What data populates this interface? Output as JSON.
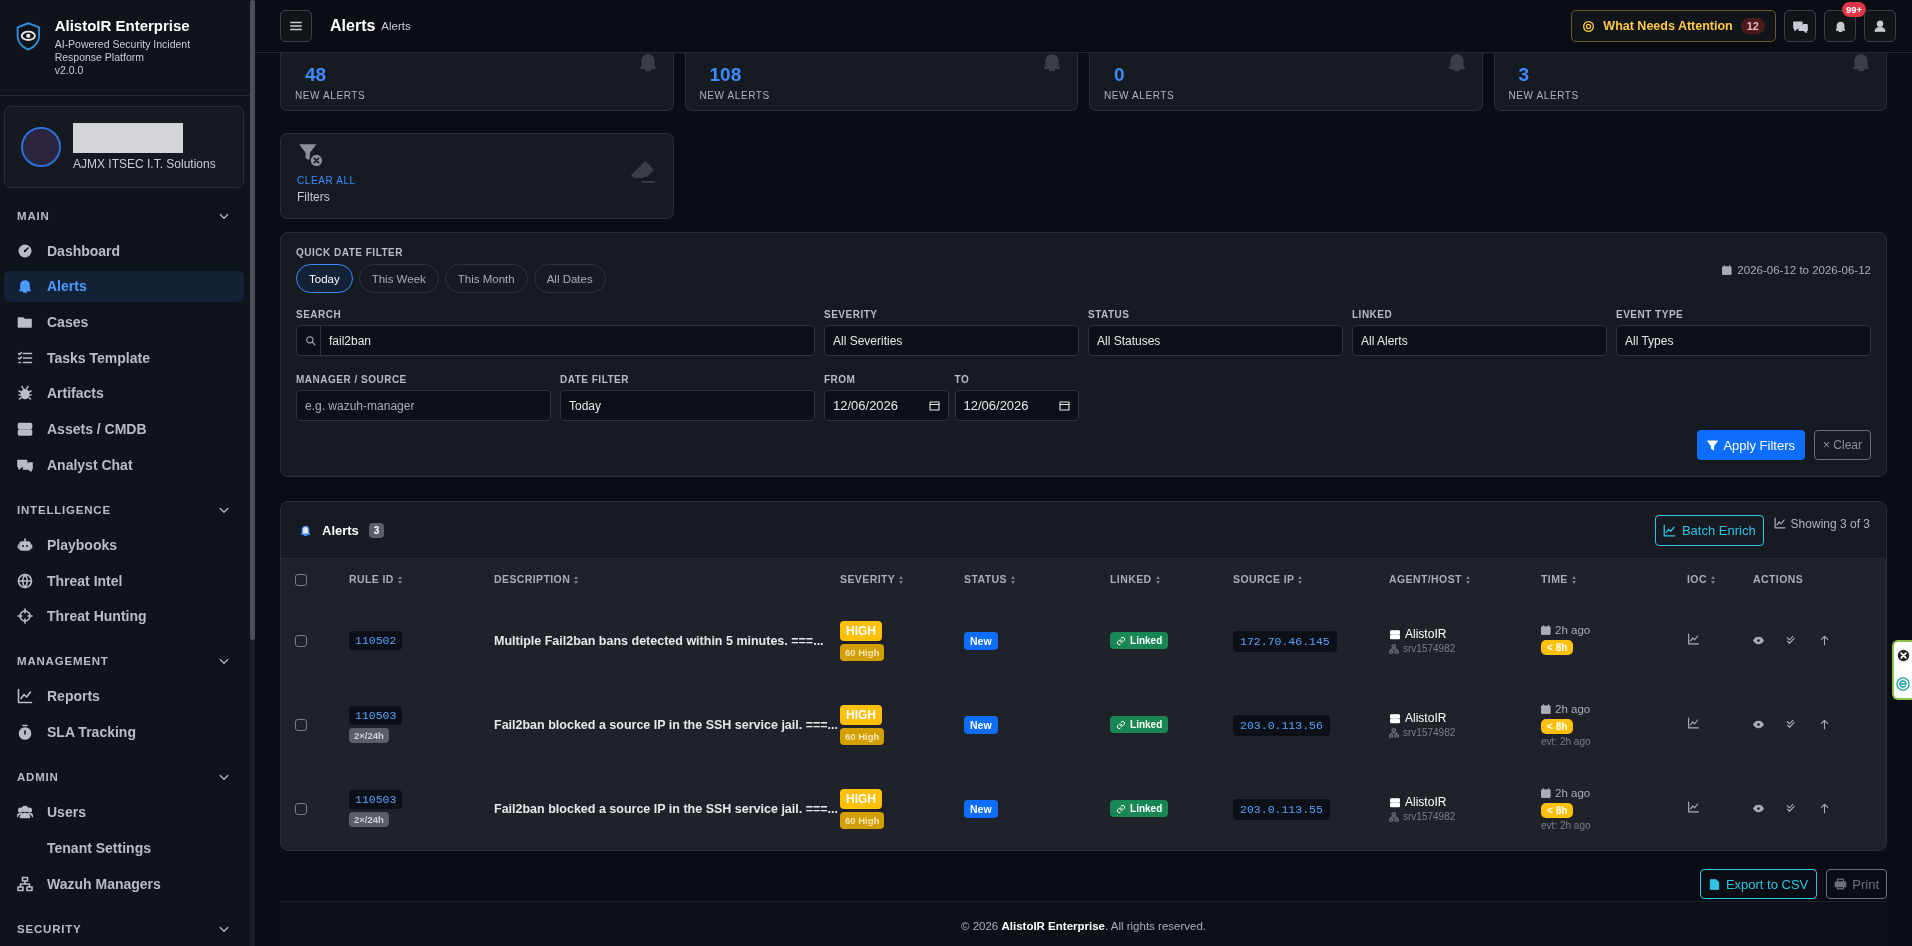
{
  "sidebar": {
    "brand": {
      "name": "AlistoIR Enterprise",
      "tagline": "AI-Powered Security Incident Response Platform",
      "version": "v2.0.0"
    },
    "user": {
      "organization": "AJMX ITSEC I.T. Solutions"
    },
    "sections": [
      {
        "title": "MAIN",
        "expanded": true,
        "items": [
          {
            "label": "Dashboard",
            "selected": false
          },
          {
            "label": "Alerts",
            "selected": true
          },
          {
            "label": "Cases",
            "selected": false
          },
          {
            "label": "Tasks Template",
            "selected": false
          },
          {
            "label": "Artifacts",
            "selected": false
          },
          {
            "label": "Assets / CMDB",
            "selected": false
          },
          {
            "label": "Analyst Chat",
            "selected": false
          }
        ]
      },
      {
        "title": "INTELLIGENCE",
        "expanded": true,
        "items": [
          {
            "label": "Playbooks",
            "selected": false
          },
          {
            "label": "Threat Intel",
            "selected": false
          },
          {
            "label": "Threat Hunting",
            "selected": false
          }
        ]
      },
      {
        "title": "MANAGEMENT",
        "expanded": true,
        "items": [
          {
            "label": "Reports",
            "selected": false
          },
          {
            "label": "SLA Tracking",
            "selected": false
          }
        ]
      },
      {
        "title": "ADMIN",
        "expanded": true,
        "items": [
          {
            "label": "Users",
            "selected": false
          },
          {
            "label": "Tenant Settings",
            "selected": false
          },
          {
            "label": "Wazuh Managers",
            "selected": false
          }
        ]
      },
      {
        "title": "SECURITY",
        "expanded": true
      }
    ]
  },
  "header": {
    "title": "Alerts",
    "breadcrumb": "Alerts",
    "attention": {
      "label": "What Needs Attention",
      "count": "12"
    },
    "notification_count": "99+"
  },
  "stats": [
    {
      "value": "48",
      "label": "NEW ALERTS"
    },
    {
      "value": "108",
      "label": "NEW ALERTS"
    },
    {
      "value": "0",
      "label": "NEW ALERTS"
    },
    {
      "value": "3",
      "label": "NEW ALERTS"
    }
  ],
  "filter_card": {
    "action": "CLEAR ALL",
    "label": "Filters"
  },
  "filters": {
    "quick_title": "QUICK DATE FILTER",
    "quick": [
      {
        "label": "Today",
        "selected": true
      },
      {
        "label": "This Week",
        "selected": false
      },
      {
        "label": "This Month",
        "selected": false
      },
      {
        "label": "All Dates",
        "selected": false
      }
    ],
    "range": "2026-06-12 to 2026-06-12",
    "fields": [
      {
        "kind": "search",
        "label": "SEARCH",
        "value": "fail2ban"
      },
      {
        "kind": "select",
        "label": "SEVERITY",
        "value": "All Severities"
      },
      {
        "kind": "select",
        "label": "STATUS",
        "value": "All Statuses"
      },
      {
        "kind": "select",
        "label": "LINKED",
        "value": "All Alerts"
      },
      {
        "kind": "select",
        "label": "EVENT TYPE",
        "value": "All Types"
      },
      {
        "kind": "text",
        "label": "MANAGER / SOURCE",
        "placeholder": "e.g. wazuh-manager"
      },
      {
        "kind": "select",
        "label": "DATE FILTER",
        "value": "Today"
      },
      {
        "kind": "date",
        "label": "FROM",
        "value": "12/06/2026"
      },
      {
        "kind": "date",
        "label": "TO",
        "value": "12/06/2026"
      }
    ],
    "apply": "Apply Filters",
    "clear": "× Clear"
  },
  "table": {
    "title": "Alerts",
    "count": "3",
    "batch": "Batch Enrich",
    "showing": "Showing 3 of 3",
    "select_all_checked": false,
    "columns": [
      {
        "label": "RULE ID",
        "sortable": true
      },
      {
        "label": "DESCRIPTION",
        "sortable": true
      },
      {
        "label": "SEVERITY",
        "sortable": true
      },
      {
        "label": "STATUS",
        "sortable": true
      },
      {
        "label": "LINKED",
        "sortable": true
      },
      {
        "label": "SOURCE IP",
        "sortable": true
      },
      {
        "label": "AGENT/HOST",
        "sortable": true
      },
      {
        "label": "TIME",
        "sortable": true
      },
      {
        "label": "IOC",
        "sortable": true
      },
      {
        "label": "ACTIONS",
        "sortable": false
      }
    ],
    "rows": [
      {
        "checked": false,
        "rule_id": "110502",
        "description": "Multiple Fail2ban bans detected within 5 minutes. ===...",
        "severity": "HIGH",
        "score": "60 High",
        "status": "New",
        "linked": "Linked",
        "source_ip": "172.70.46.145",
        "agent": "AlistoIR",
        "host": "srv1574982",
        "time": "2h ago",
        "age": "< 8h"
      },
      {
        "checked": false,
        "rule_id": "110503",
        "repeat": "2×/24h",
        "description": "Fail2ban blocked a source IP in the SSH service jail. ===...",
        "severity": "HIGH",
        "score": "60 High",
        "status": "New",
        "linked": "Linked",
        "source_ip": "203.0.113.56",
        "agent": "AlistoIR",
        "host": "srv1574982",
        "time": "2h ago",
        "age": "< 8h",
        "event_time": "evt: 2h ago"
      },
      {
        "checked": false,
        "rule_id": "110503",
        "repeat": "2×/24h",
        "description": "Fail2ban blocked a source IP in the SSH service jail. ===...",
        "severity": "HIGH",
        "score": "60 High",
        "status": "New",
        "linked": "Linked",
        "source_ip": "203.0.113.55",
        "agent": "AlistoIR",
        "host": "srv1574982",
        "time": "2h ago",
        "age": "< 8h",
        "event_time": "evt: 2h ago"
      }
    ]
  },
  "footer": {
    "export": "Export to CSV",
    "print": "Print",
    "copyright": "© 2026 **AlistoIR Enterprise**. All rights reserved."
  }
}
